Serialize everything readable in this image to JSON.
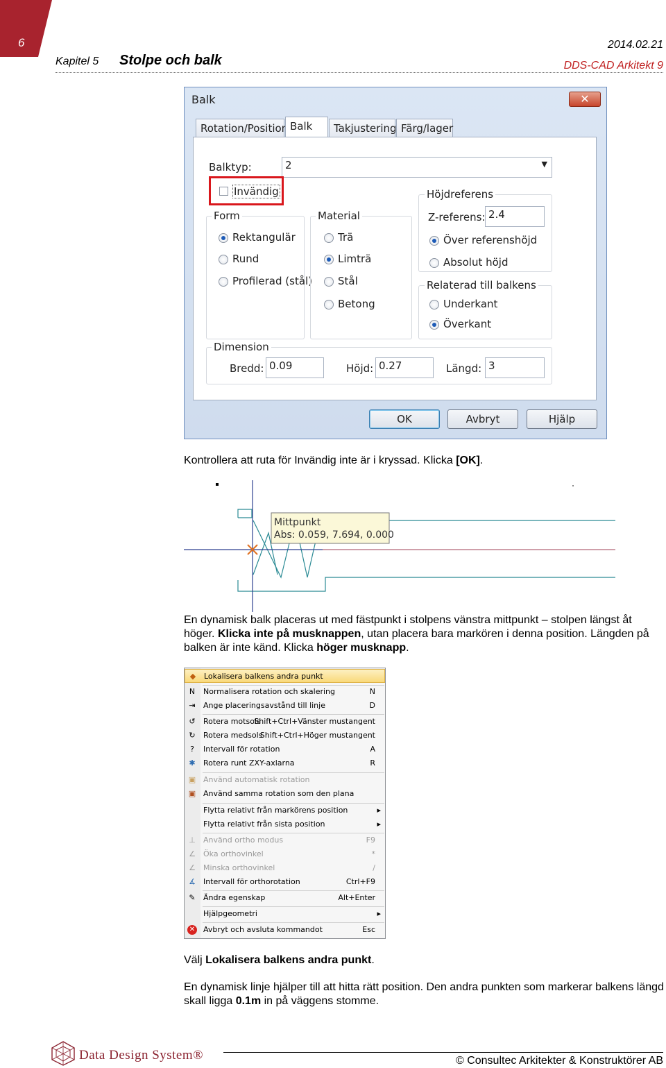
{
  "header": {
    "page_number": "6",
    "chapter_label": "Kapitel 5",
    "chapter_title": "Stolpe och balk",
    "date": "2014.02.21",
    "product": "DDS-CAD Arkitekt 9"
  },
  "dialog": {
    "title": "Balk",
    "tabs": [
      "Rotation/Position",
      "Balk",
      "Takjustering",
      "Färg/lager"
    ],
    "balktyp_label": "Balktyp:",
    "balktyp_value": "2",
    "invandig_label": "Invändig",
    "form_title": "Form",
    "form_options": [
      "Rektangulär",
      "Rund",
      "Profilerad (stål)"
    ],
    "material_title": "Material",
    "material_options": [
      "Trä",
      "Limträ",
      "Stål",
      "Betong"
    ],
    "hojd_title": "Höjdreferens",
    "zref_label": "Z-referens:",
    "zref_value": "2.4",
    "hojd_options": [
      "Över referenshöjd",
      "Absolut höjd"
    ],
    "relaterad_title": "Relaterad till balkens",
    "relaterad_options": [
      "Underkant",
      "Överkant"
    ],
    "dimension_title": "Dimension",
    "bredd_label": "Bredd:",
    "bredd_value": "0.09",
    "hojd_label": "Höjd:",
    "hojd_value": "0.27",
    "langd_label": "Längd:",
    "langd_value": "3",
    "ok_label": "OK",
    "cancel_label": "Avbryt",
    "help_label": "Hjälp"
  },
  "para1": {
    "text": "Kontrollera att ruta för Invändig inte är i kryssad. Klicka ",
    "bold": "[OK]",
    "end": "."
  },
  "cad": {
    "tooltip_line1": "Mittpunkt",
    "tooltip_line2": "Abs: 0.059, 7.694, 0.000"
  },
  "para2": {
    "t1": "En dynamisk balk placeras ut med fästpunkt i stolpens vänstra mittpunkt – stolpen längst åt höger. ",
    "b1": "Klicka inte på musknappen",
    "t2": ", utan placera bara markören i denna position. Längden på balken är inte känd. Klicka ",
    "b2": "höger musknapp",
    "t3": "."
  },
  "menu": {
    "items": [
      {
        "label": "Lokalisera balkens andra punkt",
        "shortcut": ""
      },
      {
        "label": "Normalisera rotation och skalering",
        "shortcut": "N"
      },
      {
        "label": "Ange placeringsavstånd till linje",
        "shortcut": "D"
      },
      {
        "label": "Rotera motsols",
        "shortcut": "Shift+Ctrl+Vänster mustangent"
      },
      {
        "label": "Rotera medsols",
        "shortcut": "Shift+Ctrl+Höger mustangent"
      },
      {
        "label": "Intervall för rotation",
        "shortcut": "A"
      },
      {
        "label": "Rotera runt ZXY-axlarna",
        "shortcut": "R"
      },
      {
        "label": "Använd automatisk rotation",
        "shortcut": ""
      },
      {
        "label": "Använd samma rotation som den plana",
        "shortcut": ""
      },
      {
        "label": "Flytta relativt från markörens position",
        "shortcut": "▸"
      },
      {
        "label": "Flytta relativt från sista position",
        "shortcut": "▸"
      },
      {
        "label": "Använd ortho modus",
        "shortcut": "F9"
      },
      {
        "label": "Öka orthovinkel",
        "shortcut": "*"
      },
      {
        "label": "Minska orthovinkel",
        "shortcut": "/"
      },
      {
        "label": "Intervall för orthorotation",
        "shortcut": "Ctrl+F9"
      },
      {
        "label": "Ändra egenskap",
        "shortcut": "Alt+Enter"
      },
      {
        "label": "Hjälpgeometri",
        "shortcut": "▸"
      },
      {
        "label": "Avbryt och avsluta kommandot",
        "shortcut": "Esc"
      }
    ]
  },
  "para3": {
    "t1": "Välj ",
    "b1": "Lokalisera balkens andra punkt",
    "t2": "."
  },
  "para4": {
    "t1": "En dynamisk linje hjälper till att hitta rätt position. Den andra punkten som markerar balkens längd skall ligga ",
    "b1": "0.1m",
    "t2": " in på väggens stomme."
  },
  "footer": {
    "logo_text": "Data Design System®",
    "copyright": "© Consultec Arkitekter & Konstruktörer AB"
  }
}
